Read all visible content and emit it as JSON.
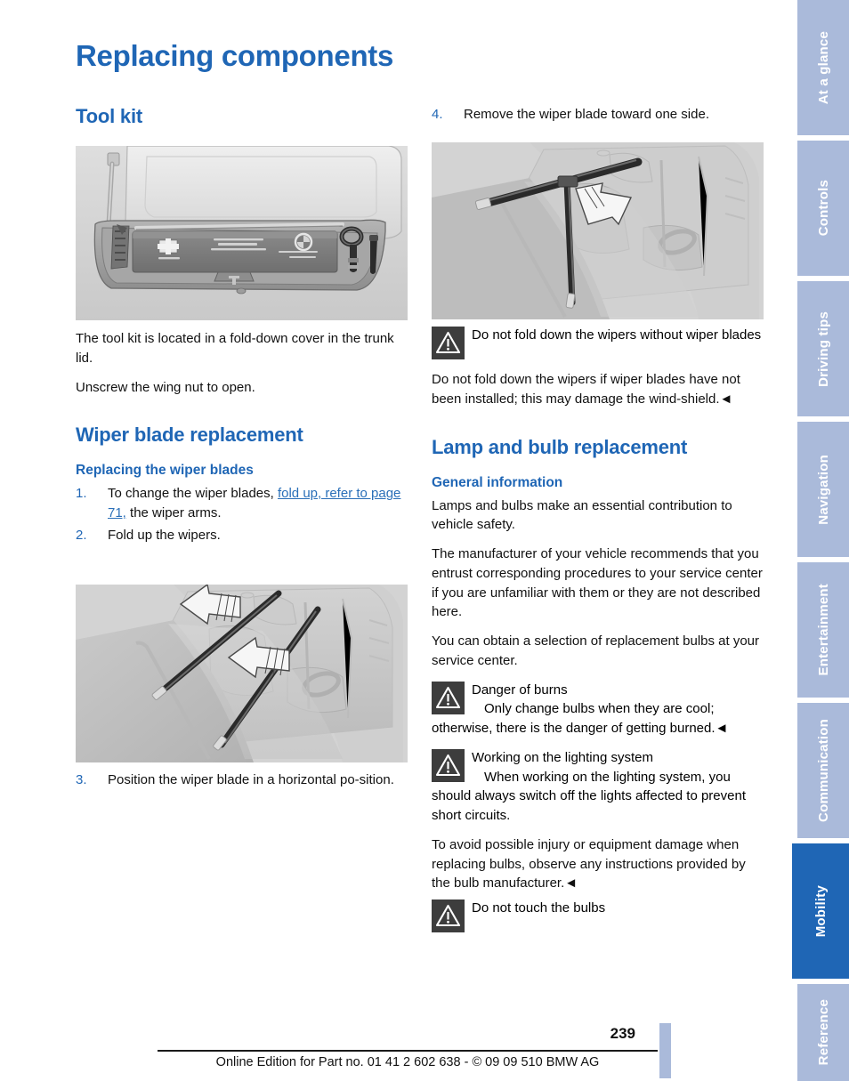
{
  "page": {
    "title": "Replacing components",
    "number": "239",
    "footer": "Online Edition for Part no. 01 41 2 602 638 - © 09 09 510 BMW AG"
  },
  "colors": {
    "accent_blue": "#1f66b5",
    "tab_blue": "#aabada",
    "tab_active_blue": "#1f66b5",
    "warning_icon_bg": "#3d3d3d"
  },
  "sidebar": {
    "tabs": [
      {
        "label": "At a glance",
        "active": false
      },
      {
        "label": "Controls",
        "active": false
      },
      {
        "label": "Driving tips",
        "active": false
      },
      {
        "label": "Navigation",
        "active": false
      },
      {
        "label": "Entertainment",
        "active": false
      },
      {
        "label": "Communication",
        "active": false
      },
      {
        "label": "Mobility",
        "active": true
      },
      {
        "label": "Reference",
        "active": false
      }
    ]
  },
  "left_column": {
    "tool_kit": {
      "heading": "Tool kit",
      "figure_caption": "tool-kit-in-trunk-lid-illustration",
      "para_1": "The tool kit is located in a fold-down cover in the trunk lid.",
      "para_2": "Unscrew the wing nut to open."
    },
    "wiper_blade": {
      "heading": "Wiper blade replacement",
      "subheading": "Replacing the wiper blades",
      "steps": [
        {
          "num": "1.",
          "text_before": "To change the wiper blades, ",
          "link": "fold up, refer to page 71,",
          "text_after": " the wiper arms."
        },
        {
          "num": "2.",
          "text_before": "Fold up the wipers.",
          "link": "",
          "text_after": ""
        },
        {
          "num": "3.",
          "text_before": "Position the wiper blade in a horizontal po-sition.",
          "link": "",
          "text_after": ""
        }
      ],
      "figure_caption": "windshield-wipers-folded-up-illustration"
    }
  },
  "right_column": {
    "step_4": {
      "num": "4.",
      "text": "Remove the wiper blade toward one side."
    },
    "figure_caption": "wiper-blade-removal-illustration",
    "warning_wipers": {
      "icon": "warning-triangle-icon",
      "title": "Do not fold down the wipers without wiper blades",
      "body": "Do not fold down the wipers if wiper blades have not been installed; this may damage the wind-shield.◄"
    },
    "lamp_bulb": {
      "heading": "Lamp and bulb replacement",
      "subheading": "General information",
      "para_1": "Lamps and bulbs make an essential contribution to vehicle safety.",
      "para_2": "The manufacturer of your vehicle recommends that you entrust corresponding procedures to your service center if you are unfamiliar with them or they are not described here.",
      "para_3": "You can obtain a selection of replacement bulbs at your service center."
    },
    "warning_burns": {
      "icon": "warning-triangle-icon",
      "title": "Danger of burns",
      "body": "Only change bulbs when they are cool; otherwise, there is the danger of getting burned.◄"
    },
    "warning_lighting": {
      "icon": "warning-triangle-icon",
      "title": "Working on the lighting system",
      "body": "When working on the lighting system, you should always switch off the lights affected to prevent short circuits.",
      "body_2": "To avoid possible injury or equipment damage when replacing bulbs, observe any instructions provided by the bulb manufacturer.◄"
    },
    "warning_touch": {
      "icon": "warning-triangle-icon",
      "title": "Do not touch the bulbs"
    }
  }
}
